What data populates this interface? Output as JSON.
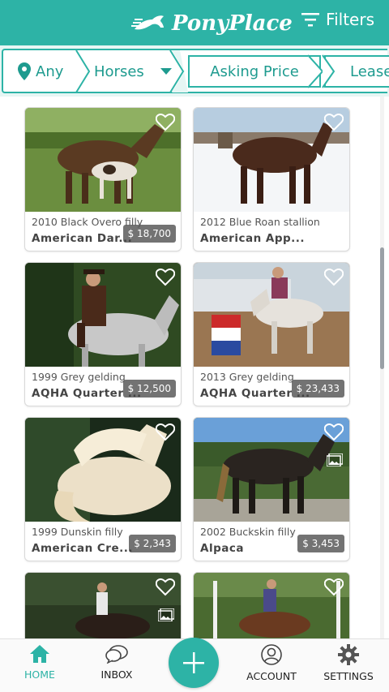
{
  "header": {
    "brand": "PonyPlace",
    "filters_label": "Filters",
    "accent": "#2db3a6"
  },
  "filter_bar": {
    "location": "Any",
    "category": "Horses",
    "price": "Asking Price",
    "lease": "Lease"
  },
  "listings": [
    {
      "subtitle": "2010 Black Overo filly",
      "title": "American Dar...",
      "price": "$ 18,700"
    },
    {
      "subtitle": "2012 Blue Roan stallion",
      "title": "American App...",
      "price": ""
    },
    {
      "subtitle": "1999 Grey gelding",
      "title": "AQHA Quarter ...",
      "price": "$ 12,500"
    },
    {
      "subtitle": "2013 Grey gelding",
      "title": "AQHA Quarter ...",
      "price": "$ 23,433"
    },
    {
      "subtitle": "1999 Dunskin filly",
      "title": "American Cre...",
      "price": "$ 2,343"
    },
    {
      "subtitle": "2002 Buckskin filly",
      "title": "Alpaca",
      "price": "$ 3,453"
    },
    {
      "subtitle": "",
      "title": "",
      "price": ""
    },
    {
      "subtitle": "",
      "title": "",
      "price": ""
    }
  ],
  "nav": {
    "home": "HOME",
    "inbox": "INBOX",
    "account": "ACCOUNT",
    "settings": "SETTINGS"
  }
}
